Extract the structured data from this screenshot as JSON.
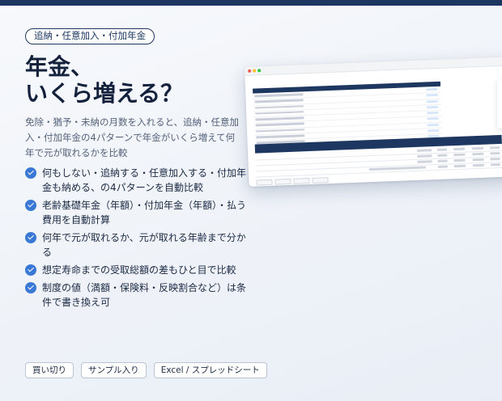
{
  "tag": "追納・任意加入・付加年金",
  "headline": [
    "年金、",
    "いくら増える？"
  ],
  "description": "免除・猶予・未納の月数を入れると、追納・任意加入・付加年金の4パターンで年金がいくら増えて何年で元が取れるかを比較",
  "features": [
    "何もしない・追納する・任意加入する・付加年金も納める、の4パターンを自動比較",
    "老齢基礎年金（年額）・付加年金（年額）・払う費用を自動計算",
    "何年で元が取れるか、元が取れる年齢まで分かる",
    "想定寿命までの受取総額の差もひと目で比較",
    "制度の値（満額・保険料・反映割合など）は条件で書き換え可"
  ],
  "pills": [
    "買い切り",
    "サンプル入り",
    "Excel / スプレッドシート"
  ],
  "icons": {
    "feature_bullet": "check-circle-icon"
  },
  "colors": {
    "navy": "#1e3761",
    "accent_blue": "#3a78d6"
  }
}
